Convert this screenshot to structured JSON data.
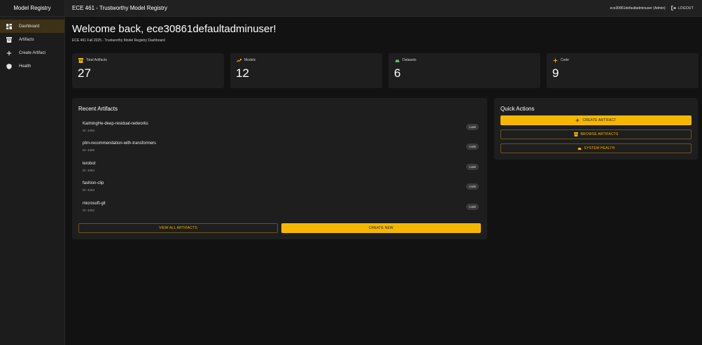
{
  "sidebar": {
    "title": "Model Registry",
    "items": [
      {
        "label": "Dashboard",
        "icon": "dashboard-icon",
        "active": true
      },
      {
        "label": "Artifacts",
        "icon": "archive-icon",
        "active": false
      },
      {
        "label": "Create Artifact",
        "icon": "plus-icon",
        "active": false
      },
      {
        "label": "Health",
        "icon": "shield-icon",
        "active": false
      }
    ]
  },
  "topbar": {
    "title": "ECE 461 - Trustworthy Model Registry",
    "user": "ece30861defaultadminuser (Admin)",
    "logout_label": "LOGOUT"
  },
  "welcome": {
    "heading": "Welcome back, ece30861defaultadminuser!",
    "subtitle": "ECE 461 Fall 2025 - Trustworthy Model Registry Dashboard"
  },
  "stats": [
    {
      "label": "Total Artifacts",
      "value": "27",
      "icon": "archive-icon",
      "color": "#f5b800"
    },
    {
      "label": "Models",
      "value": "12",
      "icon": "trending-up-icon",
      "color": "#f5b800"
    },
    {
      "label": "Datasets",
      "value": "6",
      "icon": "cloud-icon",
      "color": "#66bb6a"
    },
    {
      "label": "Code",
      "value": "9",
      "icon": "plus-icon",
      "color": "#f5b800"
    }
  ],
  "recent": {
    "title": "Recent Artifacts",
    "items": [
      {
        "name": "KaimingHe-deep-residual-networks",
        "id": "ID: 4266",
        "type": "code"
      },
      {
        "name": "ptm-recommendation-with-transformers",
        "id": "ID: 4265",
        "type": "code"
      },
      {
        "name": "lerobot",
        "id": "ID: 4264",
        "type": "code"
      },
      {
        "name": "fashion-clip",
        "id": "ID: 4263",
        "type": "code"
      },
      {
        "name": "microsoft-git",
        "id": "ID: 4262",
        "type": "code"
      }
    ],
    "view_all_label": "VIEW ALL ARTIFACTS",
    "create_new_label": "CREATE NEW"
  },
  "quick_actions": {
    "title": "Quick Actions",
    "create_label": "CREATE ARTIFACT",
    "browse_label": "BROWSE ARTIFACTS",
    "health_label": "SYSTEM HEALTH"
  },
  "colors": {
    "accent": "#f5b800",
    "background": "#121212",
    "surface": "#1e1e1e"
  }
}
